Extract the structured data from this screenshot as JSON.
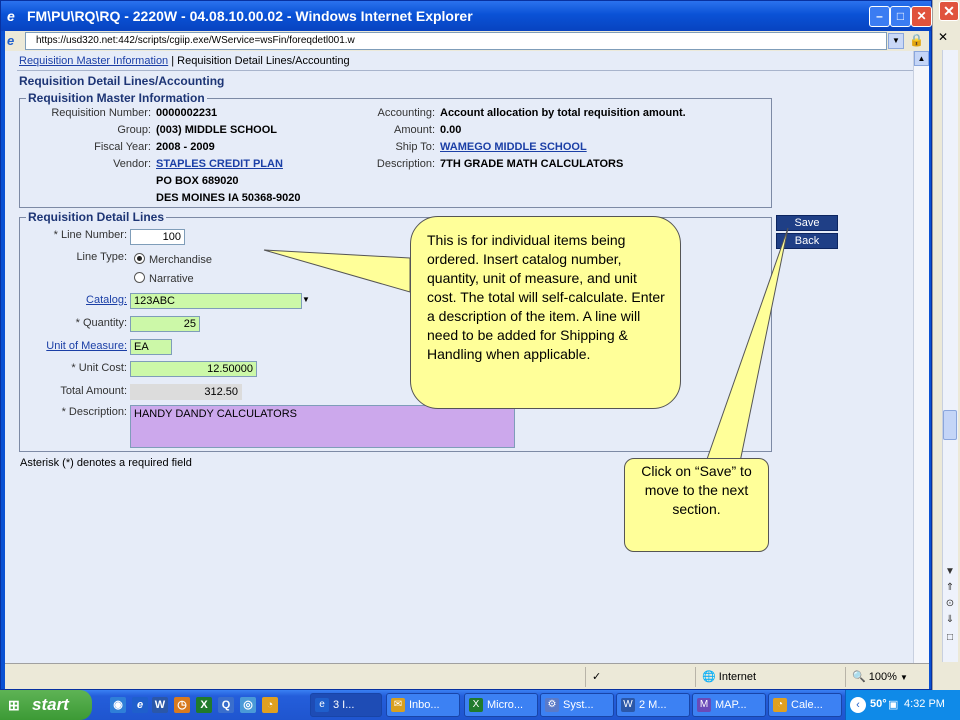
{
  "window": {
    "title": "FM\\PU\\RQ\\RQ - 2220W - 04.08.10.00.02 - Windows Internet Explorer",
    "address": "https://usd320.net:442/scripts/cgiip.exe/WService=wsFin/foreqdetl001.w"
  },
  "breadcrumb": {
    "link": "Requisition Master Information",
    "separator": "|",
    "current": "Requisition Detail Lines/Accounting"
  },
  "page_heading": "Requisition Detail Lines/Accounting",
  "master": {
    "legend": "Requisition Master Information",
    "req_number_label": "Requisition Number:",
    "req_number": "0000002231",
    "group_label": "Group:",
    "group": "(003) MIDDLE SCHOOL",
    "fiscal_year_label": "Fiscal Year:",
    "fiscal_year": "2008 - 2009",
    "vendor_label": "Vendor:",
    "vendor": "STAPLES CREDIT PLAN",
    "vendor_addr1": "PO BOX 689020",
    "vendor_addr2": "DES MOINES IA 50368-9020",
    "accounting_label": "Accounting:",
    "accounting": "Account allocation by total requisition amount.",
    "amount_label": "Amount:",
    "amount": "0.00",
    "ship_to_label": "Ship To:",
    "ship_to": "WAMEGO MIDDLE SCHOOL",
    "description_label": "Description:",
    "description": "7TH GRADE MATH CALCULATORS"
  },
  "detail": {
    "legend": "Requisition Detail Lines",
    "line_number_label": "* Line Number:",
    "line_number": "100",
    "line_type_label": "Line Type:",
    "line_type_options": [
      "Merchandise",
      "Narrative"
    ],
    "line_type_selected": "Merchandise",
    "catalog_label": "Catalog:",
    "catalog": "123ABC",
    "quantity_label": "* Quantity:",
    "quantity": "25",
    "uom_label": "Unit of Measure:",
    "uom": "EA",
    "unit_cost_label": "* Unit Cost:",
    "unit_cost": "12.50000",
    "total_label": "Total Amount:",
    "total": "312.50",
    "description_label": "* Description:",
    "description": "HANDY DANDY CALCULATORS"
  },
  "buttons": {
    "save": "Save",
    "back": "Back"
  },
  "required_note": "Asterisk (*) denotes a required field",
  "callouts": {
    "detail_lines": "This is for individual items being ordered.  Insert catalog number, quantity, unit of measure, and unit cost.  The total will self-calculate.  Enter a description of the item. A line will need to be added for Shipping & Handling when applicable.",
    "save": "Click on “Save” to move to the next section."
  },
  "statusbar": {
    "zone": "Internet",
    "zoom": "100%"
  },
  "taskbar": {
    "start": "start",
    "tasks": [
      "3 I...",
      "Inbo...",
      "Micro...",
      "Syst...",
      "2 M...",
      "MAP...",
      "Cale..."
    ],
    "temperature": "50°",
    "clock": "4:32 PM"
  },
  "colors": {
    "content_bg": "#e6ecf8",
    "required_field": "#ccf8a8",
    "description_field": "#cca8ec",
    "callout": "#ffff99",
    "button": "#1f3f86"
  }
}
